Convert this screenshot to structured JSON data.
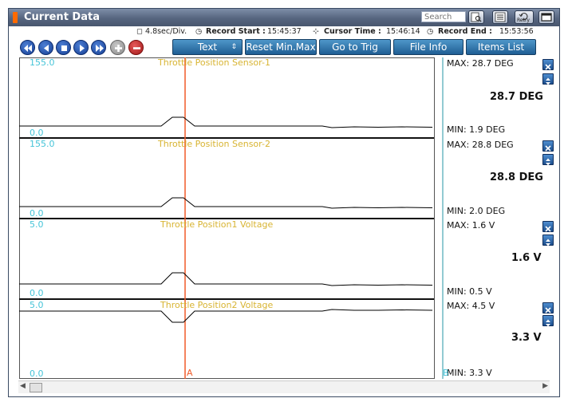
{
  "window": {
    "title": "Current Data"
  },
  "search": {
    "placeholder": "Search"
  },
  "titlebar_buttons": [
    {
      "name": "search-doc-icon"
    },
    {
      "name": "list-view-icon"
    },
    {
      "name": "retry-icon",
      "label": "Retry"
    },
    {
      "name": "window-mode-icon"
    }
  ],
  "info": {
    "scale": "4.8sec/Div.",
    "record_start_label": "Record Start :",
    "record_start": "15:45:37",
    "cursor_time_label": "Cursor Time :",
    "cursor_time": "15:46:14",
    "record_end_label": "Record End :",
    "record_end": "15:53:56"
  },
  "toolbar": {
    "nav_icons": [
      "first-icon",
      "previous-icon",
      "stop-icon",
      "next-icon",
      "last-icon",
      "zoom-in-icon",
      "zoom-out-icon"
    ],
    "display_mode": "Text",
    "reset_label": "Reset Min.Max",
    "trig_label": "Go to Trig",
    "fileinfo_label": "File Info",
    "items_label": "Items List"
  },
  "cursors": {
    "a_label": "A",
    "b_label": "B"
  },
  "panels": [
    {
      "title": "Throttle Position Sensor-1",
      "ymax": "155.0",
      "ymin": "0.0",
      "max_label": "MAX:",
      "max": "28.7 DEG",
      "current": "28.7 DEG",
      "min_label": "MIN:",
      "min": "1.9 DEG"
    },
    {
      "title": "Throttle Position Sensor-2",
      "ymax": "155.0",
      "ymin": "0.0",
      "max_label": "MAX:",
      "max": "28.8 DEG",
      "current": "28.8 DEG",
      "min_label": "MIN:",
      "min": "2.0 DEG"
    },
    {
      "title": "Throttle Position1 Voltage",
      "ymax": "5.0",
      "ymin": "0.0",
      "max_label": "MAX:",
      "max": "1.6 V",
      "current": "1.6 V",
      "min_label": "MIN:",
      "min": "0.5 V"
    },
    {
      "title": "Throttle Position2 Voltage",
      "ymax": "5.0",
      "ymin": "0.0",
      "max_label": "MAX:",
      "max": "4.5 V",
      "current": "3.3 V",
      "min_label": "MIN:",
      "min": "3.3 V"
    }
  ],
  "colors": {
    "cursor_a": "#f05a28",
    "cursor_b": "#4aa6b4",
    "trace": "#000000",
    "axis_text": "#45c4d8",
    "title_text": "#d8b432"
  }
}
